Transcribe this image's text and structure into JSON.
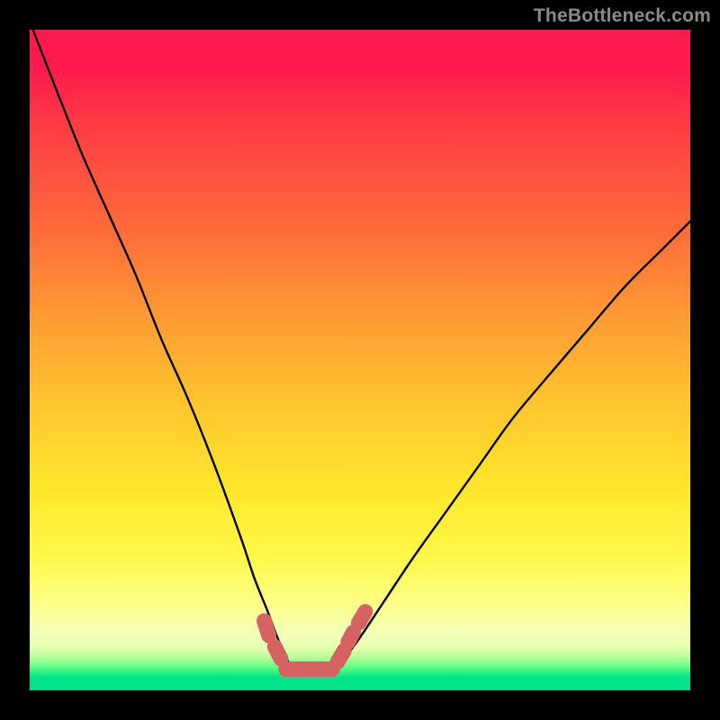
{
  "watermark": {
    "text": "TheBottleneck.com"
  },
  "gradient": {
    "top": "#ff1a4d",
    "mid1": "#ff6a3a",
    "mid2": "#ffe82c",
    "pale": "#f5ffb8",
    "green": "#00df88"
  },
  "chart_data": {
    "type": "line",
    "title": "",
    "xlabel": "",
    "ylabel": "",
    "xlim": [
      0,
      100
    ],
    "ylim": [
      0,
      100
    ],
    "grid": false,
    "legend": false,
    "series": [
      {
        "name": "curve-left",
        "stroke": "#000000",
        "x": [
          0.5,
          4,
          8,
          12,
          16,
          20,
          24,
          28,
          32,
          34,
          36,
          37.5,
          39.5
        ],
        "y": [
          100,
          91,
          81,
          72,
          63,
          53,
          44,
          34,
          23,
          17,
          12,
          8,
          3.5
        ]
      },
      {
        "name": "curve-right",
        "stroke": "#000000",
        "x": [
          47,
          50,
          54,
          58,
          63,
          68,
          73,
          78,
          84,
          90,
          96,
          100
        ],
        "y": [
          4,
          8,
          14,
          20,
          27,
          34,
          41,
          47,
          54,
          61,
          67,
          71
        ]
      },
      {
        "name": "bottom-marks",
        "stroke": "#d76262",
        "marker": "round",
        "segments": [
          {
            "x": [
              35.5,
              36.2
            ],
            "y": [
              10.5,
              8.3
            ]
          },
          {
            "x": [
              37.1,
              38.0
            ],
            "y": [
              6.6,
              4.8
            ]
          },
          {
            "x": [
              38.8,
              45.8
            ],
            "y": [
              3.2,
              3.2
            ]
          },
          {
            "x": [
              46.6,
              47.6
            ],
            "y": [
              4.3,
              6.0
            ]
          },
          {
            "x": [
              48.2,
              49.0
            ],
            "y": [
              7.3,
              8.8
            ]
          },
          {
            "x": [
              49.8,
              50.8
            ],
            "y": [
              10.2,
              11.9
            ]
          }
        ]
      }
    ]
  }
}
